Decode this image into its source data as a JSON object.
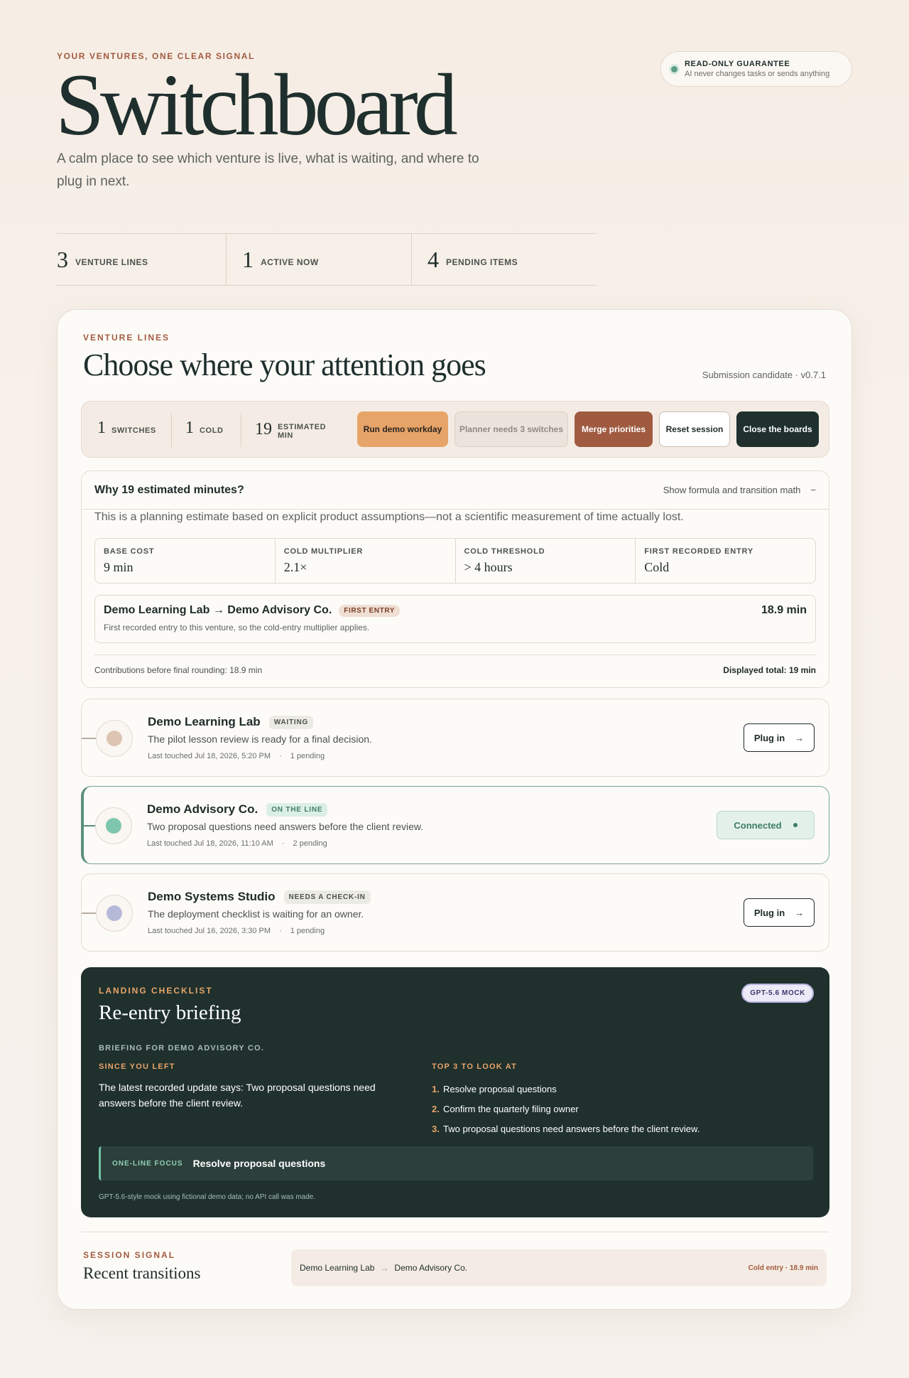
{
  "header": {
    "eyebrow": "YOUR VENTURES, ONE CLEAR SIGNAL",
    "title": "Switchboard",
    "subtitle": "A calm place to see which venture is live, what is waiting, and where to plug in next."
  },
  "guarantee": {
    "title": "READ-ONLY GUARANTEE",
    "text": "AI never changes tasks or sends anything"
  },
  "stats": [
    {
      "value": "3",
      "label": "VENTURE LINES"
    },
    {
      "value": "1",
      "label": "ACTIVE NOW"
    },
    {
      "value": "4",
      "label": "PENDING ITEMS"
    }
  ],
  "main": {
    "eyebrow": "VENTURE LINES",
    "title": "Choose where your attention goes",
    "version": "Submission candidate · v0.7.1"
  },
  "toolbar": {
    "switches": {
      "value": "1",
      "label": "SWITCHES"
    },
    "cold": {
      "value": "1",
      "label": "COLD"
    },
    "estimated": {
      "value": "19",
      "label": "ESTIMATED MIN"
    },
    "buttons": {
      "demo": "Run demo workday",
      "planner": "Planner needs 3 switches",
      "merge": "Merge priorities",
      "reset": "Reset session",
      "close": "Close the boards"
    }
  },
  "formula": {
    "question": "Why 19 estimated minutes?",
    "toggle_label": "Show formula and transition math",
    "toggle_icon": "−",
    "intro": "This is a planning estimate based on explicit product assumptions—not a scientific measurement of time actually lost.",
    "params": [
      {
        "key": "BASE COST",
        "value": "9 min"
      },
      {
        "key": "COLD MULTIPLIER",
        "value": "2.1×"
      },
      {
        "key": "COLD THRESHOLD",
        "value": "> 4 hours"
      },
      {
        "key": "FIRST RECORDED ENTRY",
        "value": "Cold"
      }
    ],
    "transition": {
      "from": "Demo Learning Lab",
      "arrow": "→",
      "to": "Demo Advisory Co.",
      "badge": "FIRST ENTRY",
      "duration": "18.9 min",
      "note": "First recorded entry to this venture, so the cold-entry multiplier applies."
    },
    "contributions": "Contributions before final rounding: 18.9 min",
    "total": "Displayed total: 19 min"
  },
  "ventures": [
    {
      "name": "Demo Learning Lab",
      "status": "WAITING",
      "description": "The pilot lesson review is ready for a final decision.",
      "last_touched": "Last touched Jul 18, 2026, 5:20 PM",
      "pending": "1 pending",
      "action": "Plug in",
      "color": "#dcc5b2"
    },
    {
      "name": "Demo Advisory Co.",
      "status": "ON THE LINE",
      "description": "Two proposal questions need answers before the client review.",
      "last_touched": "Last touched Jul 18, 2026, 11:10 AM",
      "pending": "2 pending",
      "action": "Connected",
      "color": "#7ec6ad"
    },
    {
      "name": "Demo Systems Studio",
      "status": "NEEDS A CHECK-IN",
      "description": "The deployment checklist is waiting for an owner.",
      "last_touched": "Last touched Jul 16, 2026, 3:30 PM",
      "pending": "1 pending",
      "action": "Plug in",
      "color": "#b7b9d9"
    }
  ],
  "briefing": {
    "eyebrow": "LANDING CHECKLIST",
    "title": "Re-entry briefing",
    "pill": "GPT-5.6 MOCK",
    "for_label": "BRIEFING FOR DEMO ADVISORY CO.",
    "since_heading": "SINCE YOU LEFT",
    "since_text": "The latest recorded update says: Two proposal questions need answers before the client review.",
    "top_heading": "TOP 3 TO LOOK AT",
    "top_items": [
      "Resolve proposal questions",
      "Confirm the quarterly filing owner",
      "Two proposal questions need answers before the client review."
    ],
    "focus_label": "ONE-LINE FOCUS",
    "focus_value": "Resolve proposal questions",
    "note": "GPT-5.6-style mock using fictional demo data; no API call was made."
  },
  "session": {
    "eyebrow": "SESSION SIGNAL",
    "title": "Recent transitions",
    "rows": [
      {
        "from": "Demo Learning Lab",
        "arrow": "→",
        "to": "Demo Advisory Co.",
        "tag": "Cold entry · 18.9 min"
      }
    ]
  },
  "colors": {
    "accent": "#a25a3f",
    "dark": "#1f302d",
    "orange": "#e7a468",
    "live": "#5b8f7a"
  }
}
